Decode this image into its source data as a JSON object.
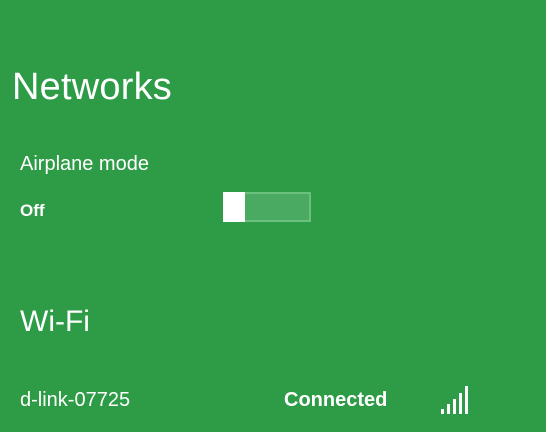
{
  "panel": {
    "title": "Networks",
    "background_color": "#2e9b47"
  },
  "airplane_mode": {
    "label": "Airplane mode",
    "state": "Off",
    "enabled": false
  },
  "wifi": {
    "heading": "Wi-Fi",
    "networks": [
      {
        "name": "d-link-07725",
        "status": "Connected",
        "signal_bars": 5,
        "signal_icon": "signal-strength-icon"
      }
    ]
  }
}
